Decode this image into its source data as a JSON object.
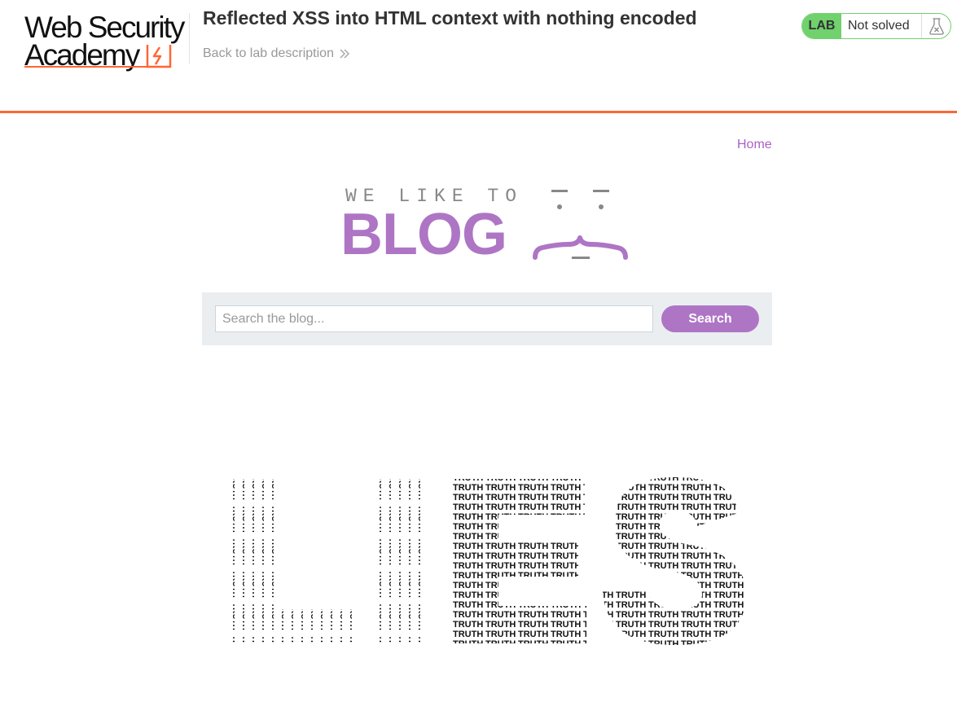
{
  "academy": {
    "logo_line1": "Web Security",
    "logo_line2": "Academy",
    "lab_title": "Reflected XSS into HTML context with nothing encoded",
    "back_link": "Back to lab description",
    "status_tag": "LAB",
    "status_text": "Not solved",
    "accent_color": "#ff6633",
    "status_color": "#70d16d"
  },
  "blog": {
    "nav_home": "Home",
    "banner_small": "WE LIKE TO",
    "banner_big": "BLOG",
    "search": {
      "placeholder": "Search the blog...",
      "value": "",
      "button_label": "Search"
    },
    "brand_color": "#ae75c5",
    "post_image": {
      "big_word": "LIES",
      "fill_word": "TRUTH"
    }
  }
}
